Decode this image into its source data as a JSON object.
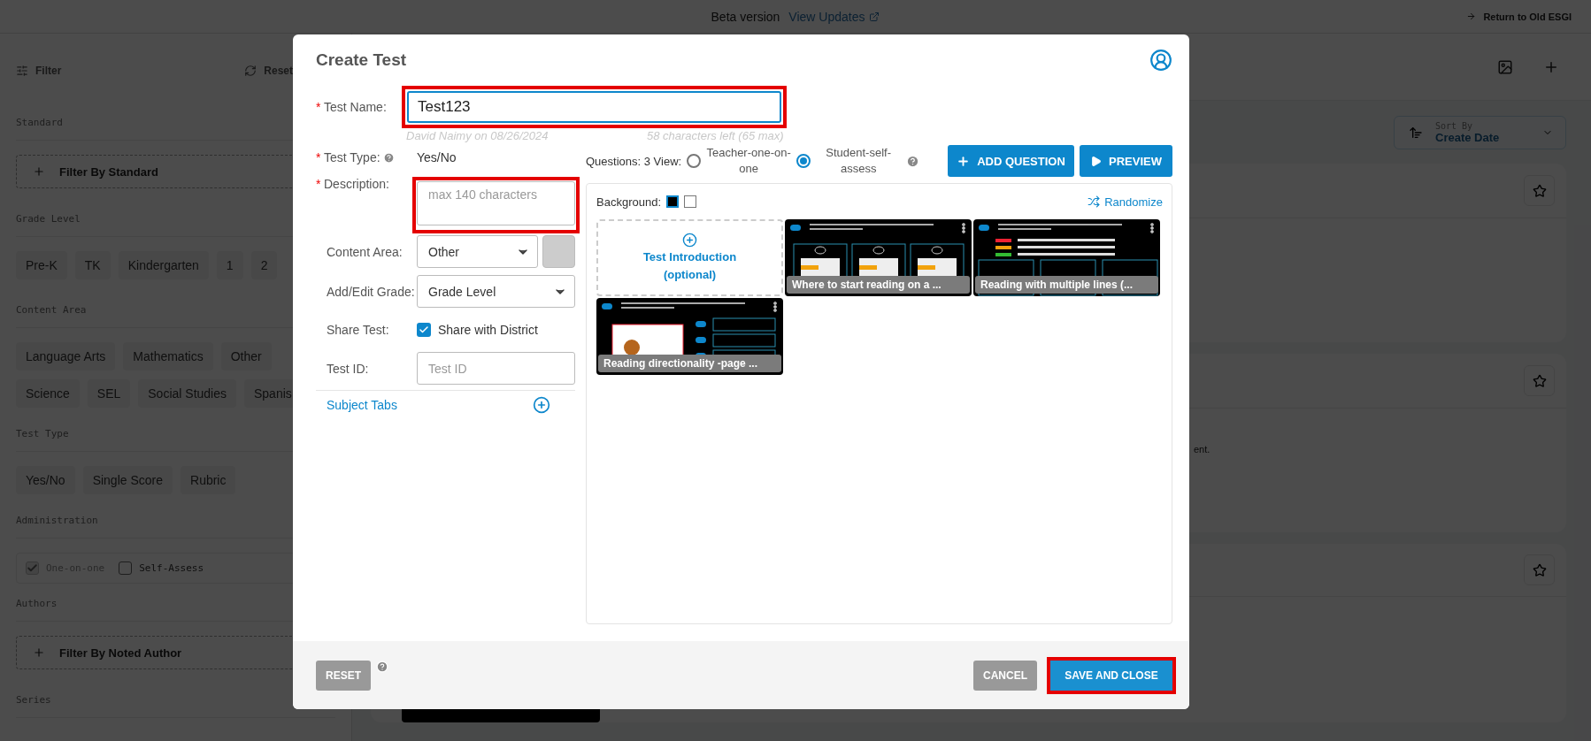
{
  "top_bar": {
    "beta_label": "Beta version",
    "updates_link": "View Updates",
    "return_link": "Return to Old ESGI"
  },
  "sidebar": {
    "filter_label": "Filter",
    "reset_label": "Reset",
    "sections": [
      {
        "kind": "add_filter",
        "title": "Standard",
        "button": "Filter By Standard"
      },
      {
        "kind": "chips",
        "title": "Grade Level",
        "chip_rows": [
          [
            "Pre-K",
            "TK",
            "Kindergarten",
            "1",
            "2"
          ]
        ]
      },
      {
        "kind": "chips",
        "title": "Content Area",
        "chip_rows": [
          [
            "Language Arts",
            "Mathematics",
            "Other"
          ],
          [
            "Science",
            "SEL",
            "Social Studies",
            "Spanis"
          ]
        ]
      },
      {
        "kind": "chips",
        "title": "Test Type",
        "chip_rows": [
          [
            "Yes/No",
            "Single Score",
            "Rubric"
          ]
        ]
      },
      {
        "kind": "checkboxes",
        "title": "Administration",
        "options": [
          {
            "label": "One-on-one",
            "checked": true,
            "disabled": true
          },
          {
            "label": "Self-Assess",
            "checked": false,
            "disabled": false
          }
        ]
      },
      {
        "kind": "add_filter",
        "title": "Authors",
        "button": "Filter By Noted Author"
      },
      {
        "kind": "title_only",
        "title": "Series"
      }
    ]
  },
  "main": {
    "sort": {
      "label": "Sort By",
      "value": "Create Date"
    },
    "cards": [
      {
        "starred": false
      },
      {
        "starred": false,
        "snippet": "ent."
      },
      {
        "starred": false,
        "has_image": true
      }
    ]
  },
  "modal": {
    "title": "Create Test",
    "test_name": {
      "label": "Test Name:",
      "required_mark": "*",
      "value": "Test123",
      "highlighted": true
    },
    "meta": {
      "author": "David Naimy on 08/26/2024",
      "counter": "58 characters left (65 max)"
    },
    "fields": [
      {
        "kind": "text",
        "label": "Test Type:",
        "required_mark": "*",
        "help": true,
        "value": "Yes/No"
      },
      {
        "kind": "textarea",
        "label": "Description:",
        "required_mark": "*",
        "placeholder": "max 140 characters",
        "highlighted": true
      },
      {
        "kind": "select_color",
        "label": "Content Area:",
        "value": "Other",
        "color": "#cccccc"
      },
      {
        "kind": "select",
        "label": "Add/Edit Grade:",
        "value": "Grade Level"
      },
      {
        "kind": "checkbox",
        "label": "Share Test:",
        "option": "Share with District",
        "checked": true
      },
      {
        "kind": "input",
        "label": "Test ID:",
        "placeholder": "Test ID"
      }
    ],
    "subject_tabs": "Subject Tabs",
    "questions_label": "Questions: 3 View:",
    "view_options": [
      {
        "label": "Teacher-one-on-one",
        "selected": false
      },
      {
        "label": "Student-self-assess",
        "selected": true
      }
    ],
    "buttons": {
      "add": "ADD QUESTION",
      "preview": "PREVIEW"
    },
    "background": {
      "label": "Background:",
      "swatches": [
        {
          "color": "#000000",
          "selected": true
        },
        {
          "color": "#ffffff",
          "selected": false
        }
      ]
    },
    "randomize": "Randomize",
    "tiles": [
      {
        "kind": "intro",
        "label": "Test Introduction",
        "sublabel": "(optional)"
      },
      {
        "kind": "three_choices",
        "caption": "Where to start reading on a ..."
      },
      {
        "kind": "three_lines",
        "caption": "Reading with multiple lines (..."
      },
      {
        "kind": "book_pages",
        "caption": "Reading directionality -page ..."
      }
    ],
    "footer": {
      "reset": "RESET",
      "cancel": "CANCEL",
      "save": {
        "label": "SAVE AND CLOSE",
        "highlighted": true
      }
    }
  }
}
